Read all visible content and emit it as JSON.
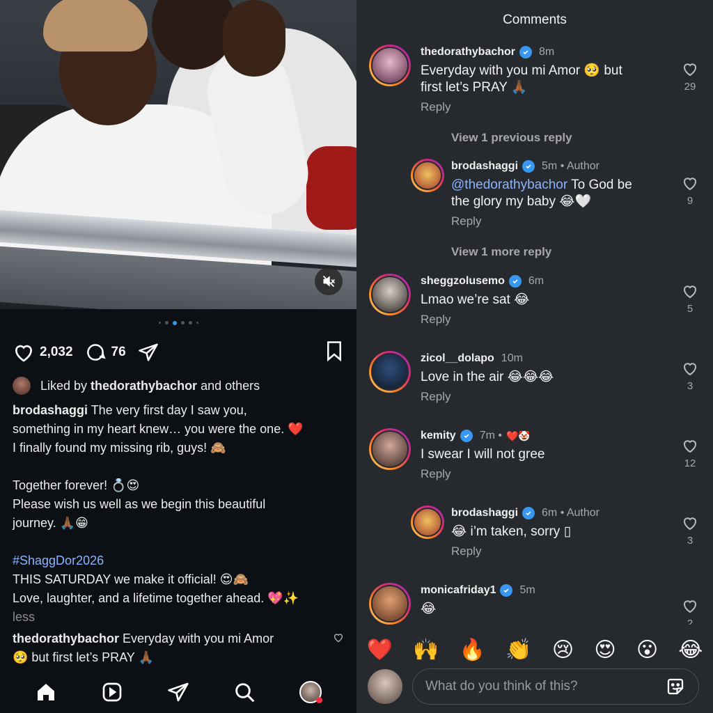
{
  "post": {
    "likes": "2,032",
    "comments": "76",
    "liked_prefix": "Liked by ",
    "liked_user": "thedorathybachor",
    "liked_suffix": " and others",
    "caption_user": "brodashaggi",
    "caption_line1": " The very first day I saw you,",
    "caption_line2": "something in my heart knew… you were the one. ❤️",
    "caption_line3": "I finally found my missing rib, guys! 🙈",
    "caption_line4": "Together forever! 💍😍",
    "caption_line5": "Please wish us well as we begin this beautiful",
    "caption_line6": "journey. 🙏🏾😁",
    "hashtag": "#ShaggDor2026",
    "caption_line7": "THIS SATURDAY we make it official! 😍🙈",
    "caption_line8": "Love, laughter, and a lifetime together ahead. 💖✨",
    "less": "less",
    "preview_user": "thedorathybachor",
    "preview_text": " Everyday with you mi Amor",
    "preview_text2": "🥺 but first let’s PRAY 🙏🏾"
  },
  "sheet": {
    "title": "Comments"
  },
  "comments": [
    {
      "user": "thedorathybachor",
      "time": "8m",
      "line1": "Everyday with you mi Amor 🥺 but",
      "line2": "first let’s PRAY 🙏🏾",
      "reply": "Reply",
      "likes": "29"
    },
    {
      "view": "View 1 previous reply"
    },
    {
      "user": "brodashaggi",
      "time": "5m • Author",
      "mention": "@thedorathybachor",
      "line1": " To God be",
      "line2": "the glory my baby 😂🤍",
      "reply": "Reply",
      "likes": "9"
    },
    {
      "view": "View 1 more reply"
    },
    {
      "user": "sheggzolusemo",
      "time": "6m",
      "line1": "Lmao we’re sat 😂",
      "reply": "Reply",
      "likes": "5"
    },
    {
      "user": "zicol__dolapo",
      "time": "10m",
      "line1": "Love in the air 😂😂😂",
      "reply": "Reply",
      "likes": "3"
    },
    {
      "user": "kemity",
      "time": "7m •",
      "badge": "❤️🤡",
      "line1": "I swear I will not gree",
      "reply": "Reply",
      "likes": "12"
    },
    {
      "user": "brodashaggi",
      "time": "6m • Author",
      "line1": "😂 i’m taken, sorry ▯",
      "reply": "Reply",
      "likes": "3"
    },
    {
      "user": "monicafriday1",
      "time": "5m",
      "line1": "😂",
      "likes": "2"
    }
  ],
  "reactions": [
    "❤️",
    "🙌",
    "🔥",
    "👏",
    "😢",
    "😍",
    "😮",
    "😂"
  ],
  "input": {
    "placeholder": "What do you think of this?"
  },
  "colors": {
    "accent": "#3897f0",
    "link": "#8ab4ff",
    "notification": "#ff3040"
  }
}
